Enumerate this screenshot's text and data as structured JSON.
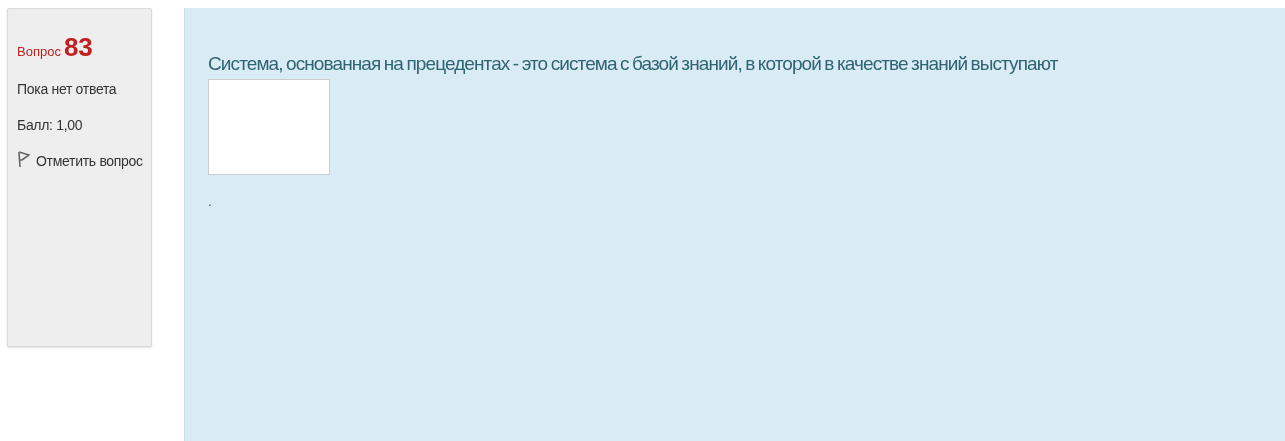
{
  "info": {
    "label": "Вопрос",
    "number": "83",
    "status": "Пока нет ответа",
    "grade": "Балл: 1,00",
    "flag_link": "Отметить вопрос"
  },
  "question": {
    "text": "Система, основанная на прецедентах - это система с базой знаний, в которой в качестве знаний выступают",
    "after_answer": "."
  }
}
